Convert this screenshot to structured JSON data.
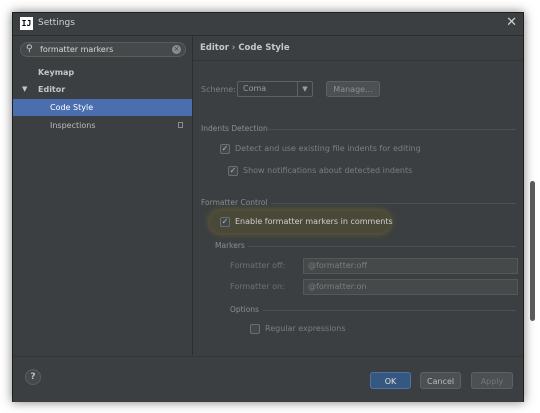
{
  "window": {
    "title": "Settings",
    "app_icon_text": "IJ"
  },
  "search": {
    "value": "formatter markers"
  },
  "sidebar": {
    "items": [
      {
        "label": "Keymap"
      },
      {
        "label": "Editor"
      },
      {
        "label": "Code Style",
        "selected": true
      },
      {
        "label": "Inspections"
      }
    ]
  },
  "breadcrumb": {
    "parent": "Editor",
    "separator": "›",
    "current": "Code Style"
  },
  "scheme": {
    "label": "Scheme:",
    "value": "Coma",
    "manage_label": "Manage..."
  },
  "indents_detection": {
    "title": "Indents Detection",
    "detect_label": "Detect and use existing file indents for editing",
    "notify_label": "Show notifications about detected indents"
  },
  "formatter_control": {
    "title": "Formatter Control",
    "enable_label": "Enable formatter markers in comments",
    "markers_title": "Markers",
    "off_label": "Formatter off:",
    "off_value": "@formatter:off",
    "on_label": "Formatter on:",
    "on_value": "@formatter:on",
    "options_title": "Options",
    "regex_label": "Regular expressions"
  },
  "footer": {
    "help_label": "?",
    "ok_label": "OK",
    "cancel_label": "Cancel",
    "apply_label": "Apply"
  },
  "colors": {
    "accent_selected": "#4b6eaf",
    "background": "#3c3f41",
    "ok_button": "#365880"
  }
}
